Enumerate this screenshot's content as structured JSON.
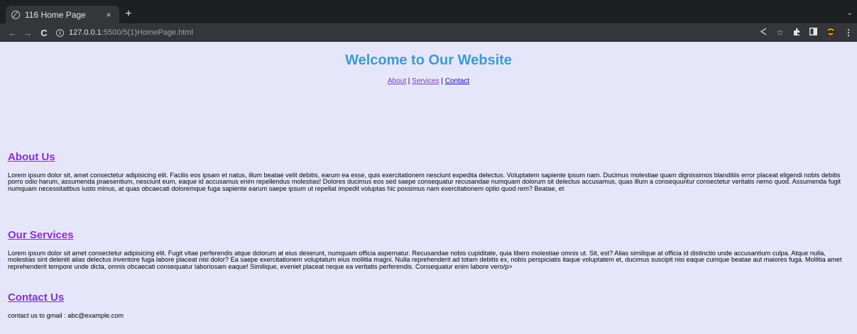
{
  "browser": {
    "tab_title": "116 Home Page",
    "tab_close": "×",
    "new_tab": "+",
    "tab_menu": "⌄",
    "back": "←",
    "forward": "→",
    "reload": "C",
    "info": "i",
    "url_host": "127.0.0.1",
    "url_path": ":5500/5(1)HomePage.html",
    "icons": [
      "share-icon",
      "star-icon",
      "extensions-icon",
      "sidepanel-icon",
      "profile-icon",
      "menu-icon"
    ]
  },
  "page": {
    "title": "Welcome to Our Website",
    "nav": {
      "about": "About",
      "services": "Services",
      "contact": "Contact",
      "separator": "|"
    },
    "about": {
      "heading": "About Us",
      "text": "Lorem ipsum dolor sit, amet consectetur adipisicing elit. Facilis eos ipsam et natus, illum beatae velit debitis, earum ea esse, quis exercitationem nesciunt expedita delectus. Voluptatem sapiente ipsum nam. Ducimus molestiae quam dignissimos blanditiis error placeat eligendi nobis debitis porro odio harum, assumenda praesentium, nesciunt eum, eaque id accusamus enim repellendus molestias! Dolores ducimus eos sed saepe consequatur recusandae numquam dolorum sit delectus accusamus, quas illum a consequuntur consectetur veritatis nemo quod. Assumenda fugit numquam necessitatibus iusto minus, at quas obcaecati doloremque fuga sapiente earum saepe ipsum ut repellat impedit voluptas hic possimus nam exercitationem optio quod rem? Beatae, et"
    },
    "services": {
      "heading": "Our Services",
      "text": "Lorem ipsum dolor sit amet consectetur adipisicing elit. Fugit vitae perferendis atque dolorum at eius deserunt, numquam officia aspernatur. Recusandae nobis cupiditate, quia libero molestiae omnis ut. Sit, est? Alias similique at officia id distinctio unde accusantium culpa. Atque nulla, molestias sint deleniti alias delectus inventore fuga labore placeat nisi dolor? Ea saepe exercitationem voluptatum eius mollitia magni. Nulla reprehenderit ad totam debitis ex, nobis perspiciatis itaque voluptatem et, ducimus suscipit nisi eaque cumque beatae aut maiores fuga. Mollitia amet reprehenderit tempore unde dicta, omnis obcaecati consequatur laboriosam eaque! Similique, eveniet placeat neque ea veritatis perferendis. Consequatur enim labore vero/p>"
    },
    "contact": {
      "heading": "Contact Us",
      "text": "contact us to gmail : abc@example.com"
    }
  },
  "colors": {
    "page_bg": "#e6e6fa",
    "title": "#3d9ad6",
    "section_heading": "#8a2be2",
    "visited_link": "#7b3fc4",
    "link": "#1a0dab"
  }
}
